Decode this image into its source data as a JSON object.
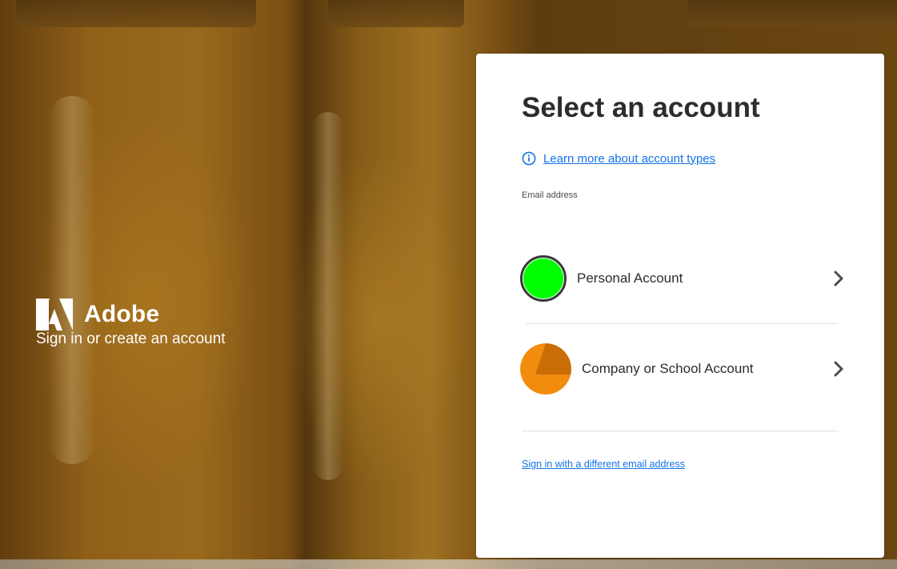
{
  "brand": {
    "name": "Adobe",
    "tagline": "Sign in or create an account"
  },
  "card": {
    "title": "Select an account",
    "learn_more_link": "Learn more about account types",
    "email_label": "Email address",
    "accounts": [
      {
        "label": "Personal Account",
        "avatar_color": "#00ff00"
      },
      {
        "label": "Company or School Account",
        "avatar_color": "#f28c0f"
      }
    ],
    "different_email_link": "Sign in with a different email address"
  },
  "colors": {
    "link": "#1473e6",
    "title": "#2c2c2c",
    "card_background": "#ffffff"
  },
  "icons": {
    "info": "info-circle-icon",
    "chevron": "chevron-right-icon",
    "logo": "adobe-logo-icon"
  }
}
